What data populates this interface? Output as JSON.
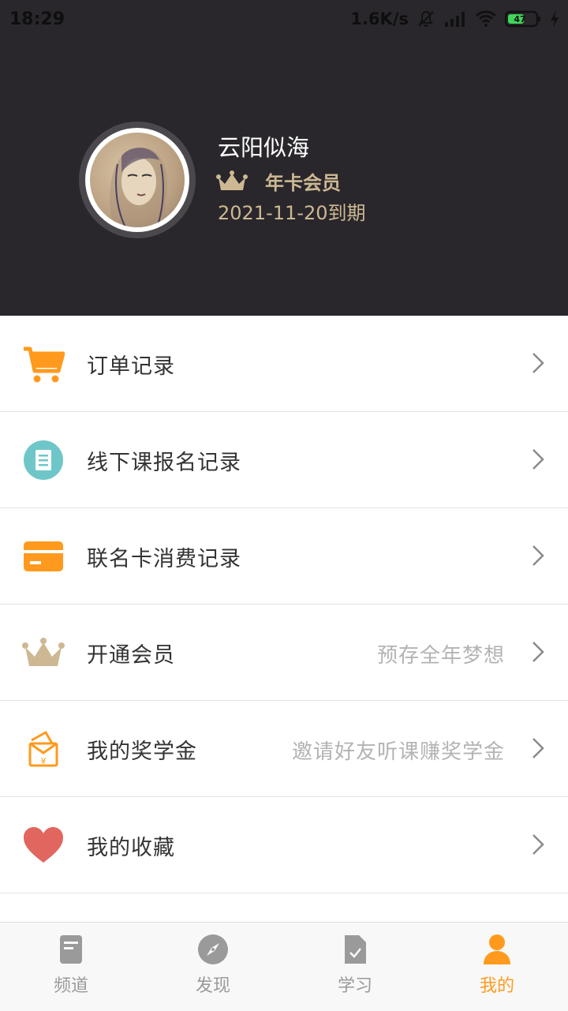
{
  "status_bar": {
    "time": "18:29",
    "speed": "1.6K/s",
    "icons": [
      "bell-off-icon",
      "hd-signal-icon",
      "wifi-icon",
      "battery-icon",
      "charging-icon"
    ],
    "battery": "47"
  },
  "profile": {
    "username": "云阳似海",
    "member_label": "年卡会员",
    "expiry": "2021-11-20到期",
    "header_bg": "#29272c",
    "gold": "#cdb893"
  },
  "menu": [
    {
      "label": "订单记录",
      "hint": "",
      "icon": "shopping-cart-icon"
    },
    {
      "label": "线下课报名记录",
      "hint": "",
      "icon": "document-circle-icon"
    },
    {
      "label": "联名卡消费记录",
      "hint": "",
      "icon": "card-icon"
    },
    {
      "label": "开通会员",
      "hint": "预存全年梦想",
      "icon": "crown-icon"
    },
    {
      "label": "我的奖学金",
      "hint": "邀请好友听课赚奖学金",
      "icon": "scholarship-icon"
    },
    {
      "label": "我的收藏",
      "hint": "",
      "icon": "heart-icon"
    }
  ],
  "tabs": [
    {
      "label": "频道",
      "icon": "channel-icon",
      "active": false
    },
    {
      "label": "发现",
      "icon": "compass-icon",
      "active": false
    },
    {
      "label": "学习",
      "icon": "study-icon",
      "active": false
    },
    {
      "label": "我的",
      "icon": "person-icon",
      "active": true
    }
  ],
  "colors": {
    "accent": "#ff9a1e",
    "teal": "#6fc6c8",
    "heart": "#e0665f"
  }
}
